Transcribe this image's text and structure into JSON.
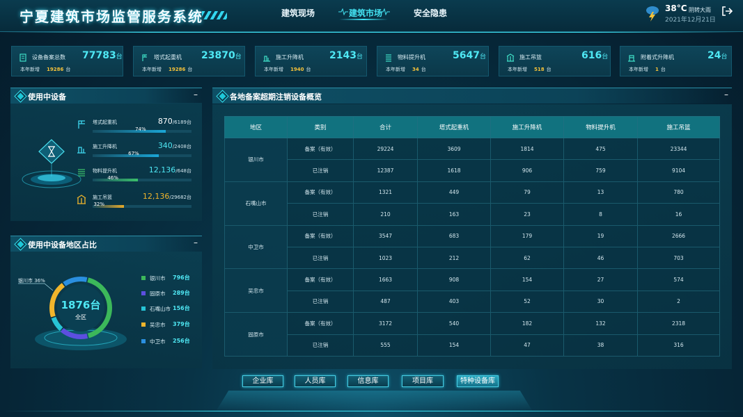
{
  "app": {
    "title": "宁夏建筑市场监管服务系统"
  },
  "nav": [
    {
      "label": "建筑现场"
    },
    {
      "label": "建筑市场"
    },
    {
      "label": "安全隐患"
    }
  ],
  "weather": {
    "temp": "38°C",
    "desc": "阴转大雨",
    "date": "2021年12月21日",
    "icon": "thunderstorm-icon"
  },
  "stats": [
    {
      "label": "设备备案总数",
      "value": "77783",
      "unit": "台",
      "sub_label": "本年新增",
      "sub_value": "19286",
      "sub_unit": "台"
    },
    {
      "label": "塔式起重机",
      "value": "23870",
      "unit": "台",
      "sub_label": "本年新增",
      "sub_value": "19286",
      "sub_unit": "台"
    },
    {
      "label": "施工升降机",
      "value": "2143",
      "unit": "台",
      "sub_label": "本年新增",
      "sub_value": "1940",
      "sub_unit": "台"
    },
    {
      "label": "物料提升机",
      "value": "5647",
      "unit": "台",
      "sub_label": "本年新增",
      "sub_value": "34",
      "sub_unit": "台"
    },
    {
      "label": "施工吊篮",
      "value": "616",
      "unit": "台",
      "sub_label": "本年新增",
      "sub_value": "518",
      "sub_unit": "台"
    },
    {
      "label": "附着式升降机",
      "value": "24",
      "unit": "台",
      "sub_label": "本年新增",
      "sub_value": "1",
      "sub_unit": "台"
    }
  ],
  "in_use": {
    "title": "使用中设备",
    "items": [
      {
        "name": "塔式起重机",
        "count": "870",
        "total": "/6189台",
        "percent": 74,
        "percent_label": "74%",
        "color": "#1aa6d6"
      },
      {
        "name": "施工升降机",
        "count": "340",
        "total": "/2408台",
        "percent": 67,
        "percent_label": "67%",
        "color": "#1aa6d6"
      },
      {
        "name": "物料提升机",
        "count": "12,136",
        "total": "/648台",
        "percent": 46,
        "percent_label": "46%",
        "color": "#3cc06b"
      },
      {
        "name": "施工吊篮",
        "count": "12,136",
        "total": "/29682台",
        "percent": 32,
        "percent_label": "32%",
        "color": "#e6a92a"
      }
    ]
  },
  "region": {
    "title": "使用中设备地区占比",
    "total": "1876台",
    "total_label": "全区",
    "callout": "银川市 36%",
    "items": [
      {
        "name": "银川市",
        "value": "796台",
        "num": 796,
        "color": "#3cb85a"
      },
      {
        "name": "固原市",
        "value": "289台",
        "num": 289,
        "color": "#5c4fe0"
      },
      {
        "name": "石嘴山市",
        "value": "156台",
        "num": 156,
        "color": "#27c4d6"
      },
      {
        "name": "吴忠市",
        "value": "379台",
        "num": 379,
        "color": "#f0b52c"
      },
      {
        "name": "中卫市",
        "value": "256台",
        "num": 256,
        "color": "#2a8fe0"
      }
    ]
  },
  "overview": {
    "title": "各地备案超期注销设备概览",
    "headers": [
      "地区",
      "类别",
      "合计",
      "塔式起重机",
      "施工升降机",
      "物料提升机",
      "施工吊篮"
    ],
    "rows": [
      {
        "city": "银川市",
        "records": [
          [
            "备案（有效）",
            "29224",
            "3609",
            "1814",
            "475",
            "23344"
          ],
          [
            "已注销",
            "12387",
            "1618",
            "906",
            "759",
            "9104"
          ]
        ]
      },
      {
        "city": "石嘴山市",
        "records": [
          [
            "备案（有效）",
            "1321",
            "449",
            "79",
            "13",
            "780"
          ],
          [
            "已注销",
            "210",
            "163",
            "23",
            "8",
            "16"
          ]
        ]
      },
      {
        "city": "中卫市",
        "records": [
          [
            "备案（有效）",
            "3547",
            "683",
            "179",
            "19",
            "2666"
          ],
          [
            "已注销",
            "1023",
            "212",
            "62",
            "46",
            "703"
          ]
        ]
      },
      {
        "city": "吴忠市",
        "records": [
          [
            "备案（有效）",
            "1663",
            "908",
            "154",
            "27",
            "574"
          ],
          [
            "已注销",
            "487",
            "403",
            "52",
            "30",
            "2"
          ]
        ]
      },
      {
        "city": "固原市",
        "records": [
          [
            "备案（有效）",
            "3172",
            "540",
            "182",
            "132",
            "2318"
          ],
          [
            "已注销",
            "555",
            "154",
            "47",
            "38",
            "316"
          ]
        ]
      }
    ]
  },
  "bottom_nav": [
    {
      "label": "企业库"
    },
    {
      "label": "人员库"
    },
    {
      "label": "信息库"
    },
    {
      "label": "项目库"
    },
    {
      "label": "特种设备库"
    }
  ],
  "panel_control": {
    "minimize": "–"
  }
}
